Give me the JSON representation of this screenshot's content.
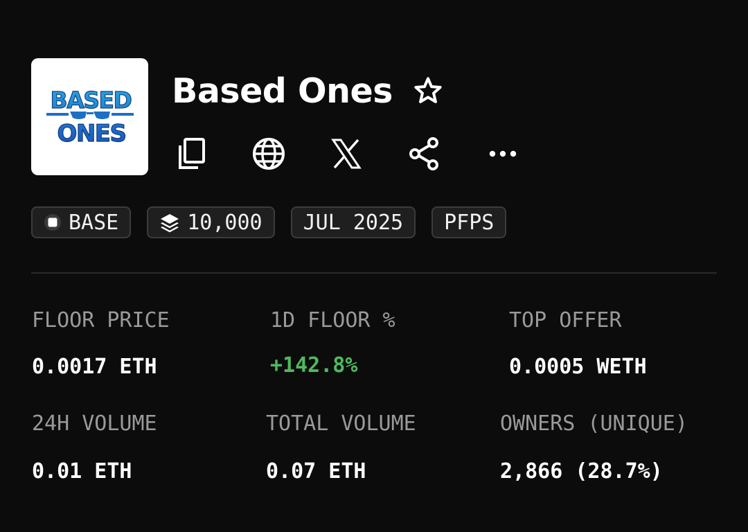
{
  "collection": {
    "name": "Based Ones",
    "logo_text_top": "BASED",
    "logo_text_bottom": "ONES"
  },
  "actions": [
    {
      "icon": "copy-icon"
    },
    {
      "icon": "globe-icon"
    },
    {
      "icon": "x-icon"
    },
    {
      "icon": "share-icon"
    },
    {
      "icon": "more-icon"
    }
  ],
  "favorite_icon": "star-icon",
  "tags": {
    "chain": "BASE",
    "supply": "10,000",
    "date": "JUL 2025",
    "category": "PFPS"
  },
  "stats": [
    {
      "label": "FLOOR PRICE",
      "value": "0.0017 ETH"
    },
    {
      "label": "1D FLOOR %",
      "value": "+142.8%"
    },
    {
      "label": "TOP OFFER",
      "value": "0.0005 WETH"
    },
    {
      "label": "24H VOLUME",
      "value": "0.01 ETH"
    },
    {
      "label": "TOTAL VOLUME",
      "value": "0.07 ETH"
    },
    {
      "label": "OWNERS (UNIQUE)",
      "value": "2,866 (28.7%)"
    }
  ],
  "colors": {
    "background": "#0c0c0c",
    "positive": "#4fb95e",
    "logo_blue": "#1f8fd6",
    "logo_dark_blue": "#1d63c6"
  }
}
